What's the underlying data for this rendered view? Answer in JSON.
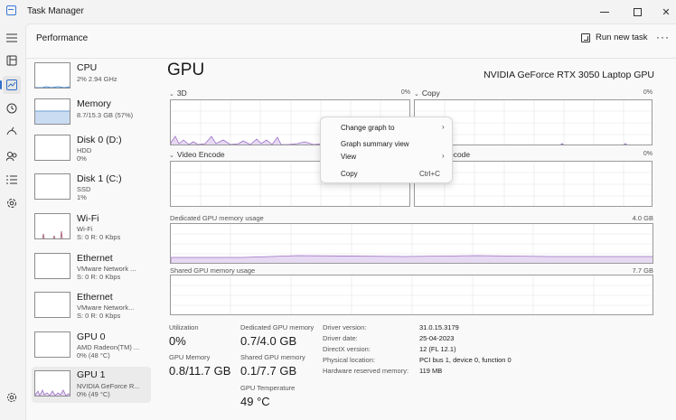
{
  "window": {
    "title": "Task Manager"
  },
  "header": {
    "page_title": "Performance",
    "run_task_label": "Run new task"
  },
  "sidebar": {
    "devices": [
      {
        "name": "CPU",
        "detail1": "2% 2.94 GHz",
        "detail2": "",
        "detail3": ""
      },
      {
        "name": "Memory",
        "detail1": "8.7/15.3 GB (57%)",
        "detail2": "",
        "detail3": ""
      },
      {
        "name": "Disk 0 (D:)",
        "detail1": "HDD",
        "detail2": "0%",
        "detail3": ""
      },
      {
        "name": "Disk 1 (C:)",
        "detail1": "SSD",
        "detail2": "1%",
        "detail3": ""
      },
      {
        "name": "Wi-Fi",
        "detail1": "Wi-Fi",
        "detail2": "S: 0 R: 0 Kbps",
        "detail3": ""
      },
      {
        "name": "Ethernet",
        "detail1": "VMware Network ...",
        "detail2": "S: 0 R: 0 Kbps",
        "detail3": ""
      },
      {
        "name": "Ethernet",
        "detail1": "VMware Network...",
        "detail2": "S: 0 R: 0 Kbps",
        "detail3": ""
      },
      {
        "name": "GPU 0",
        "detail1": "AMD Radeon(TM) ...",
        "detail2": "0% (48 °C)",
        "detail3": ""
      },
      {
        "name": "GPU 1",
        "detail1": "NVIDIA GeForce R...",
        "detail2": "0% (49 °C)",
        "detail3": ""
      }
    ]
  },
  "gpu": {
    "title": "GPU",
    "model": "NVIDIA GeForce RTX 3050 Laptop GPU",
    "engines": [
      {
        "label": "3D",
        "pct": "0%"
      },
      {
        "label": "Copy",
        "pct": "0%"
      },
      {
        "label": "Video Encode",
        "pct": "0%"
      },
      {
        "label": "Video Decode",
        "pct": "0%"
      }
    ],
    "dedicated_label": "Dedicated GPU memory usage",
    "dedicated_max": "4.0 GB",
    "shared_label": "Shared GPU memory usage",
    "shared_max": "7.7 GB",
    "stats": {
      "utilization_label": "Utilization",
      "utilization_value": "0%",
      "gpu_memory_label": "GPU Memory",
      "gpu_memory_value": "0.8/11.7 GB",
      "dedicated_label": "Dedicated GPU memory",
      "dedicated_value": "0.7/4.0 GB",
      "shared_label": "Shared GPU memory",
      "shared_value": "0.1/7.7 GB",
      "temp_label": "GPU Temperature",
      "temp_value": "49 °C"
    },
    "info": [
      {
        "label": "Driver version:",
        "value": "31.0.15.3179"
      },
      {
        "label": "Driver date:",
        "value": "25-04-2023"
      },
      {
        "label": "DirectX version:",
        "value": "12 (FL 12.1)"
      },
      {
        "label": "Physical location:",
        "value": "PCI bus 1, device 0, function 0"
      },
      {
        "label": "Hardware reserved memory:",
        "value": "119 MB"
      }
    ]
  },
  "context_menu": {
    "change_graph": "Change graph to",
    "summary_view": "Graph summary view",
    "view": "View",
    "copy": "Copy",
    "copy_shortcut": "Ctrl+C"
  },
  "colors": {
    "gpu_line": "#9b6fc4",
    "gpu_fill": "#e6d9f2",
    "memory_fill": "#c9dcf2",
    "wifi_line": "#b06c86",
    "grid": "#ececec"
  }
}
